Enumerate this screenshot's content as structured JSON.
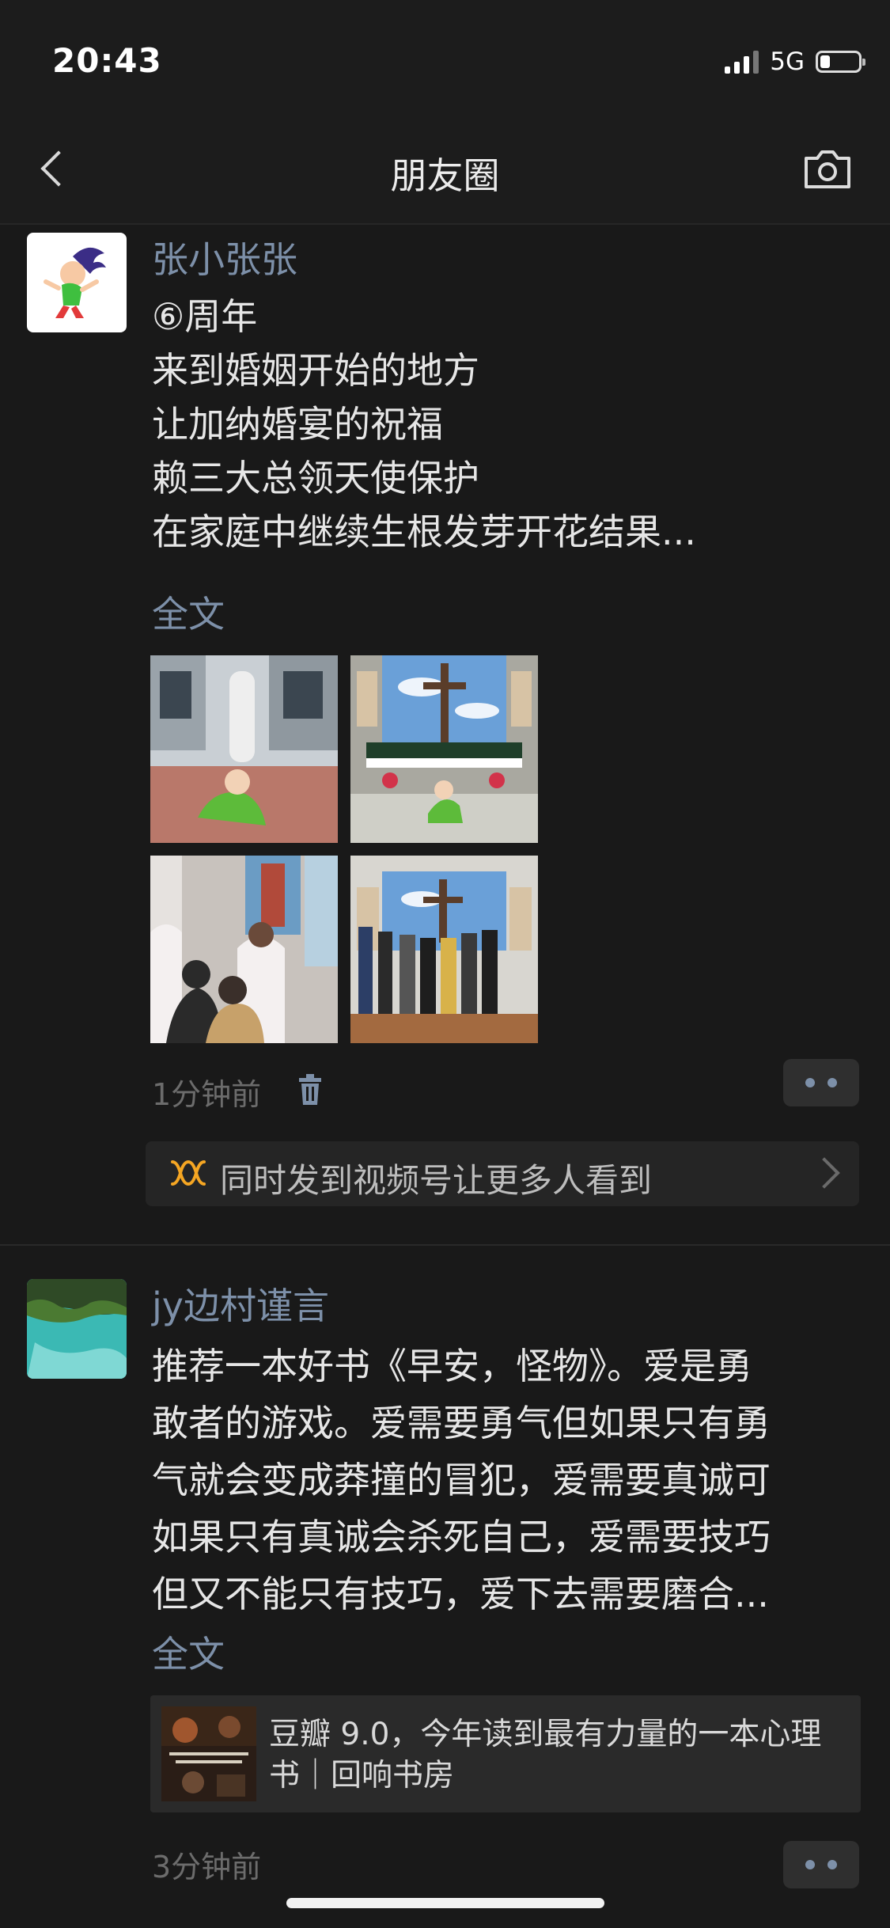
{
  "status_bar": {
    "time": "20:43",
    "network": "5G",
    "battery_level": 0.25
  },
  "nav": {
    "title": "朋友圈"
  },
  "posts": [
    {
      "author": "张小张张",
      "text_lines": [
        "⑥周年",
        "来到婚姻开始的地方",
        "让加纳婚宴的祝福",
        "赖三大总领天使保护",
        "在家庭中继续生根发芽开花结果..."
      ],
      "full_text_label": "全文",
      "time_ago": "1分钟前",
      "channels_prompt": "同时发到视频号让更多人看到"
    },
    {
      "author": "jy边村谨言",
      "text_lines": [
        "推荐一本好书《早安，怪物》。爱是勇",
        "敢者的游戏。爱需要勇气但如果只有勇",
        "气就会变成莽撞的冒犯，爱需要真诚可",
        "如果只有真诚会杀死自己，爱需要技巧",
        "但又不能只有技巧，爱下去需要磨合..."
      ],
      "full_text_label": "全文",
      "link_title": "豆瓣 9.0，今年读到最有力量的一本心理书｜回响书房",
      "time_ago": "3分钟前"
    }
  ],
  "icons": [
    "back-icon",
    "camera-icon",
    "trash-icon",
    "more-icon",
    "channels-icon",
    "chevron-right-icon"
  ],
  "colors": {
    "background": "#191919",
    "link_blue": "#7d90a9",
    "text": "#e6e6e6",
    "channels_orange": "#f5a623"
  }
}
